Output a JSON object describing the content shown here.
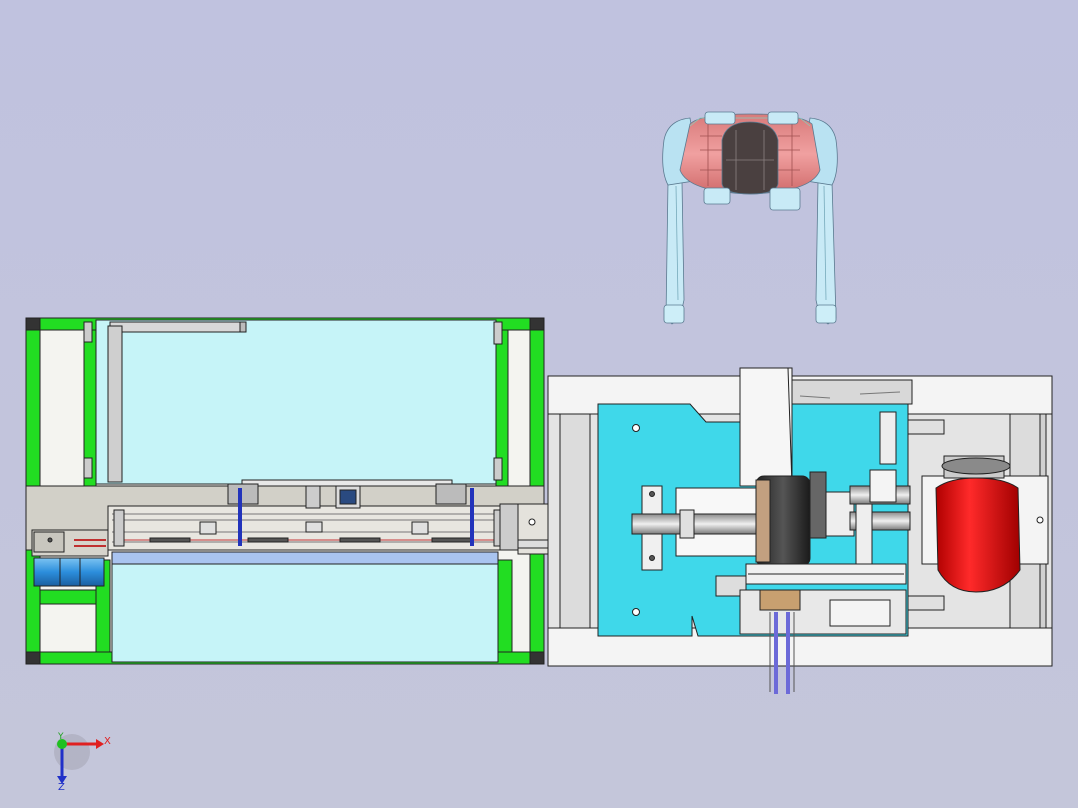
{
  "viewport": {
    "background": "#c0c2de",
    "edge_color": "#222222"
  },
  "colors": {
    "frame_green": "#22dd22",
    "frame_dark": "#333333",
    "panel_lightcyan": "#c6f4f8",
    "panel_blue": "#a9c4f0",
    "rail_gray": "#d2d0c8",
    "plate_cyan": "#3fd8ea",
    "base_white": "#f2f2f2",
    "motor_red": "#e81010",
    "motor_blue": "#3a9fe0",
    "hand_skin": "#e98a8a",
    "hand_brown": "#4a4040",
    "hand_glass": "#b9e2f2",
    "slot_blue": "#2233bb",
    "wire_purple": "#6c6ad8"
  },
  "components": [
    "conveyor-frame",
    "control-box",
    "blue-motor",
    "brush-wheel",
    "red-motor",
    "gripper-hand"
  ],
  "triad": {
    "x_label": "X",
    "y_label": "Y",
    "z_label": "Z"
  }
}
